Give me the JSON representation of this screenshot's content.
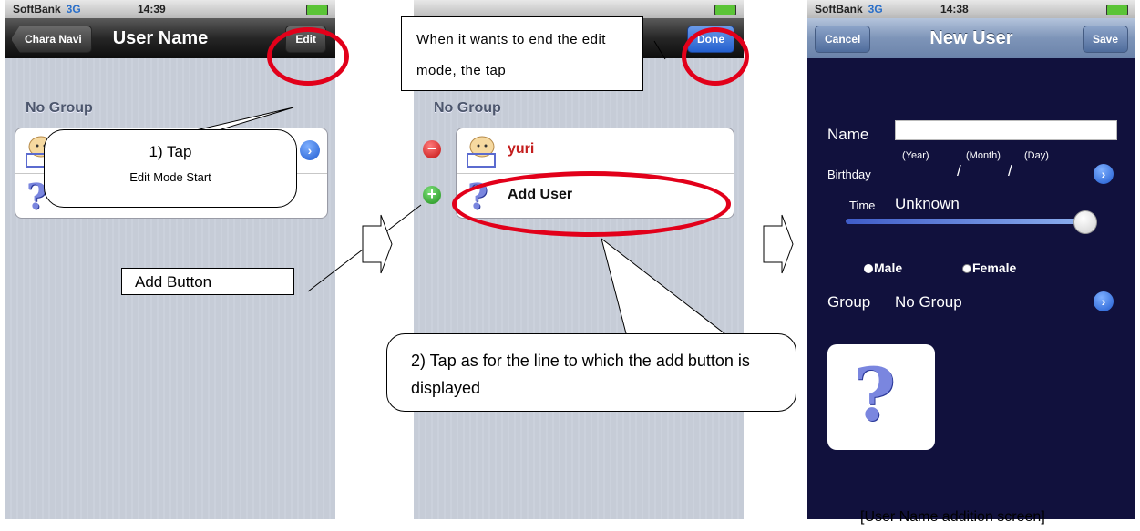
{
  "status": {
    "carrier": "SoftBank",
    "network": "3G",
    "time1": "14:39",
    "time3": "14:38"
  },
  "phone1": {
    "back_label": "Chara Navi",
    "title": "User Name",
    "edit_label": "Edit",
    "section_header": "No Group"
  },
  "phone2": {
    "done_label": "Done",
    "section_header": "No Group",
    "rows": [
      {
        "label": "yuri"
      },
      {
        "label": "Add User"
      }
    ]
  },
  "phone3": {
    "cancel_label": "Cancel",
    "title": "New User",
    "save_label": "Save",
    "name_label": "Name",
    "name_value": "",
    "birthday_label": "Birthday",
    "year_label": "(Year)",
    "month_label": "(Month)",
    "day_label": "(Day)",
    "date_sep1": "/",
    "date_sep2": "/",
    "time_label": "Time",
    "time_value": "Unknown",
    "slider_level": 1.0,
    "male_label": "Male",
    "female_label": "Female",
    "group_label": "Group",
    "group_value": "No Group"
  },
  "callouts": {
    "tap_title": "1) Tap",
    "tap_sub": "Edit Mode Start",
    "add_button": "Add Button",
    "done_hint": "When it wants to end the edit mode, the tap",
    "tap_line": "2) Tap as for the line to which the add button is displayed",
    "caption": "[User Name addition screen]"
  },
  "colors": {
    "highlight": "#e2001a",
    "dark_bg": "#11113d",
    "link_red": "#c41e1e"
  }
}
